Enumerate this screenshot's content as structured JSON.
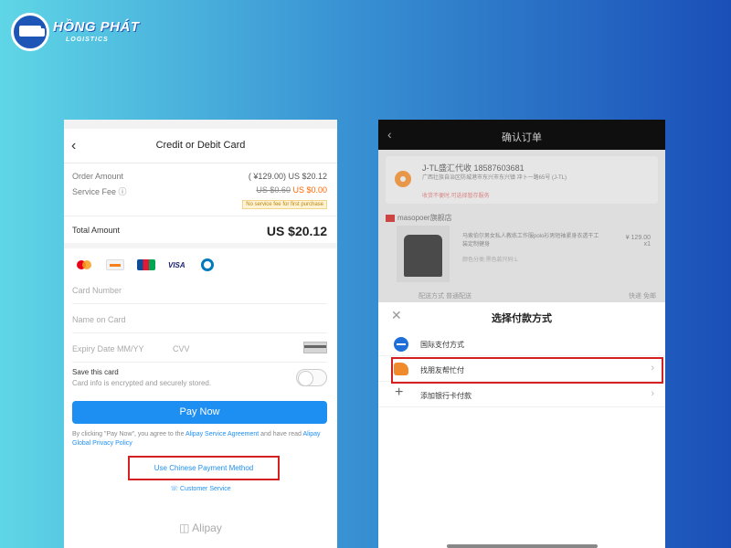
{
  "logo": {
    "name": "HỒNG PHÁT",
    "subtitle": "LOGISTICS",
    "icon": "truck-icon"
  },
  "left_screen": {
    "back_glyph": "‹",
    "title": "Credit or Debit Card",
    "order_amount": {
      "label": "Order Amount",
      "original": "( ¥129.00)",
      "value": "US $20.12"
    },
    "service_fee": {
      "label": "Service Fee",
      "info_glyph": "ⓘ",
      "old_value": "US $0.60",
      "value": "US $0.00",
      "note": "No service fee for first purchase"
    },
    "total": {
      "label": "Total Amount",
      "value": "US $20.12"
    },
    "card_brands": [
      "mastercard-icon",
      "discover-icon",
      "jcb-icon",
      "VISA",
      "diners-icon"
    ],
    "fields": {
      "card_number": "Card Number",
      "name_on_card": "Name on Card",
      "expiry": "Expiry Date MM/YY",
      "cvv": "CVV"
    },
    "save_card": {
      "title": "Save this card",
      "subtitle": "Card info is encrypted and securely stored."
    },
    "pay_now": "Pay Now",
    "agreement": {
      "prefix": "By clicking \"Pay Now\", you agree to the ",
      "link1": "Alipay Service Agreement",
      "middle": " and have read ",
      "link2": "Alipay Global Privacy Policy"
    },
    "chinese_method": "Use Chinese Payment Method",
    "customer_service": "Customer Service",
    "brand_footer": "Alipay"
  },
  "right_screen": {
    "back_glyph": "‹",
    "title": "确认订单",
    "address": {
      "name": "J-TL盛汇代收",
      "phone": "18587603681",
      "detail": "广西壮族自治区防城港市东兴市东兴镇 冲卜一路65号 (J-TL)",
      "warning": "收货不便时,可选择暂存服务"
    },
    "shop": "masopoer旗舰店",
    "product": {
      "name": "马索伯尔男女私人教练工作服polo衫男短袖紧身衣透干工装定制健身",
      "price": "¥ 129.00",
      "qty": "x1",
      "spec": "颜色分类:黑色款尺码:L"
    },
    "delivery": {
      "label": "配送方式",
      "value": "普通配送",
      "right": "快递 免邮"
    },
    "sheet": {
      "close_glyph": "✕",
      "title": "选择付款方式",
      "options": [
        {
          "label": "国际支付方式",
          "icon": "globe-icon",
          "arrow": ""
        },
        {
          "label": "找朋友帮忙付",
          "icon": "hand-pay-icon",
          "arrow": "›"
        },
        {
          "label": "添加银行卡付款",
          "icon": "plus-icon",
          "arrow": "›"
        }
      ]
    }
  }
}
